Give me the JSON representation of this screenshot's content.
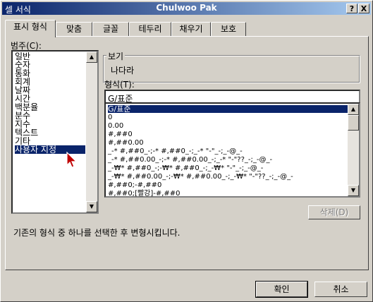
{
  "window": {
    "title_left": "셀 서식",
    "title_center": "Chulwoo Pak",
    "help_glyph": "?",
    "close_glyph": "X"
  },
  "tabs": [
    "표시 형식",
    "맞춤",
    "글꼴",
    "테두리",
    "채우기",
    "보호"
  ],
  "category": {
    "label": "범주(C):",
    "items": [
      "일반",
      "숫자",
      "통화",
      "회계",
      "날짜",
      "시간",
      "백분율",
      "분수",
      "지수",
      "텍스트",
      "기타",
      "사용자 지정"
    ],
    "selected": "사용자 지정"
  },
  "sample": {
    "label": "보기",
    "value": "나다라"
  },
  "format": {
    "label": "형식(T):",
    "value": "G/표준",
    "items": [
      "G/표준",
      "0",
      "0.00",
      "#,##0",
      "#,##0.00",
      "_-* #,##0_-;-* #,##0_-;_-* \"-\"_-;_-@_-",
      "_-* #,##0.00_-;-* #,##0.00_-;_-* \"-\"??_-;_-@_-",
      "_-₩* #,##0_-;-₩* #,##0_-;_-₩* \"-\"_-;_-@_-",
      "_-₩* #,##0.00_-;-₩* #,##0.00_-;_-₩* \"-\"??_-;_-@_-",
      "#,##0;-#,##0",
      "#,##0;[빨강]-#,##0"
    ],
    "selected": "G/표준"
  },
  "delete_button": "삭제(D)",
  "description": "기존의 형식 중 하나를 선택한 후 변형시킵니다.",
  "ok_button": "확인",
  "cancel_button": "취소"
}
